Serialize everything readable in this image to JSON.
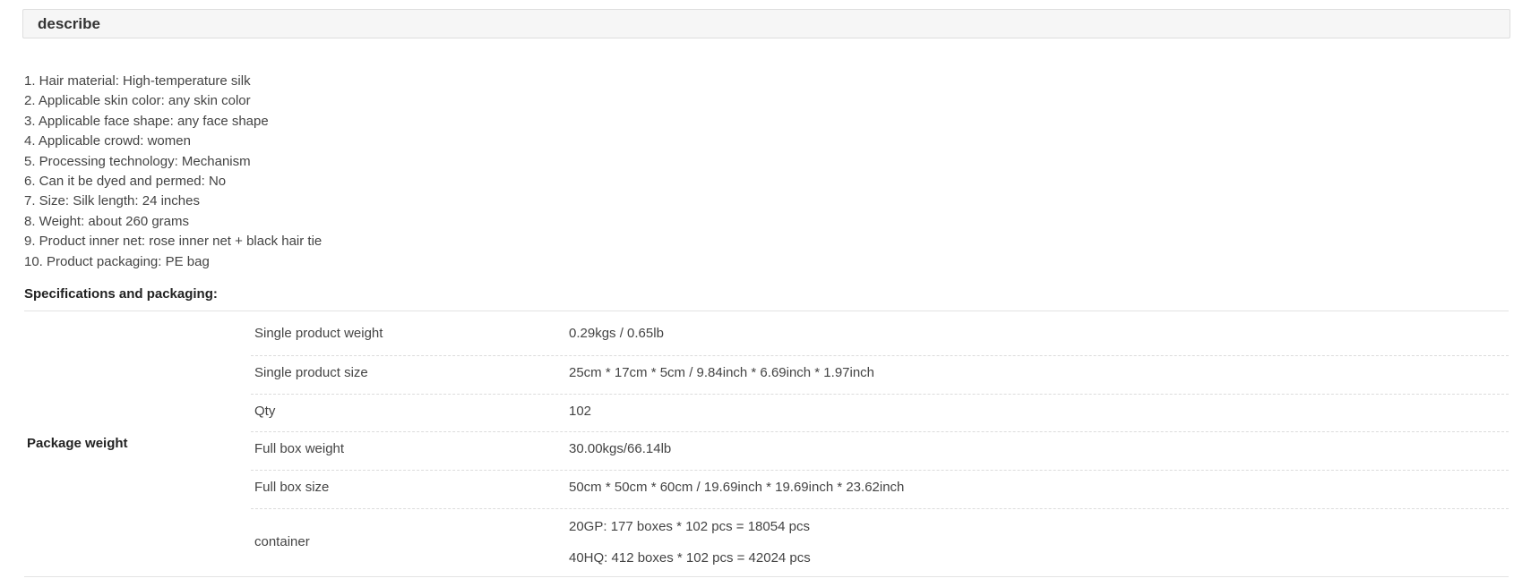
{
  "describe": {
    "title": "describe"
  },
  "features": [
    "1. Hair material: High-temperature silk",
    "2. Applicable skin color: any skin color",
    "3. Applicable face shape: any face shape",
    "4. Applicable crowd: women",
    "5. Processing technology: Mechanism",
    "6. Can it be dyed and permed: No",
    "7. Size: Silk length: 24 inches",
    "8. Weight: about 260 grams",
    "9. Product inner net: rose inner net + black hair tie",
    "10. Product packaging: PE bag"
  ],
  "specifications": {
    "heading": "Specifications and packaging:",
    "group_label": "Package weight",
    "rows": [
      {
        "key": "Single product weight",
        "value": "0.29kgs / 0.65lb"
      },
      {
        "key": "Single product size",
        "value": "25cm * 17cm * 5cm / 9.84inch * 6.69inch * 1.97inch"
      },
      {
        "key": "Qty",
        "value": "102"
      },
      {
        "key": "Full box weight",
        "value": "30.00kgs/66.14lb"
      },
      {
        "key": "Full box size",
        "value": "50cm * 50cm * 60cm / 19.69inch * 19.69inch * 23.62inch"
      },
      {
        "key": "container",
        "values": [
          "20GP: 177 boxes * 102 pcs = 18054 pcs",
          "40HQ: 412 boxes * 102 pcs = 42024 pcs"
        ]
      }
    ]
  }
}
